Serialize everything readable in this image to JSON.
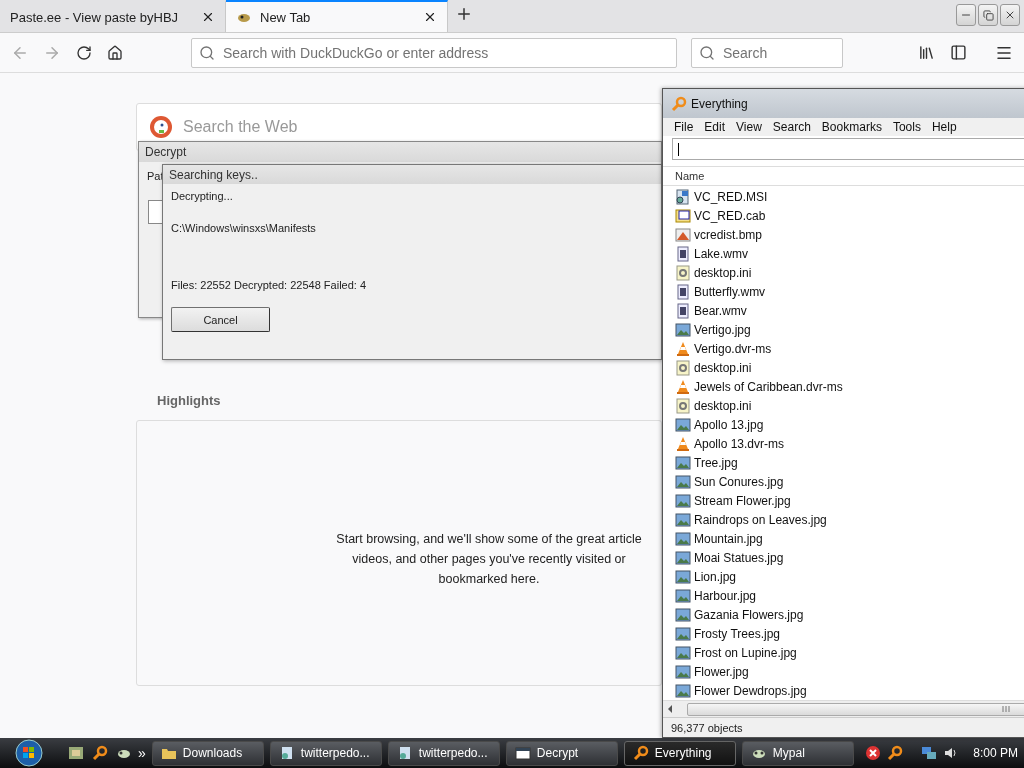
{
  "browser": {
    "tabs": [
      {
        "title": "Paste.ee - View paste byHBJ",
        "selected": false
      },
      {
        "title": "New Tab",
        "selected": true
      }
    ],
    "address_bar": {
      "placeholder": "Search with DuckDuckGo or enter address"
    },
    "search_bar": {
      "placeholder": "Search"
    },
    "page": {
      "web_search": {
        "placeholder": "Search the Web"
      },
      "highlights": {
        "heading": "Highlights",
        "message_lines": [
          "Start browsing, and we'll show some of the great article",
          "videos, and other pages you've recently visited or",
          "bookmarked here."
        ]
      }
    }
  },
  "decrypt_window": {
    "title": "Decrypt",
    "label": "Pat"
  },
  "progress_dialog": {
    "title": "Searching keys..",
    "status": "Decrypting...",
    "path": "C:\\Windows\\winsxs\\Manifests",
    "summary": "Files: 22552 Decrypted: 22548 Failed: 4",
    "button": "Cancel"
  },
  "everything_window": {
    "title": "Everything",
    "menu": [
      "File",
      "Edit",
      "View",
      "Search",
      "Bookmarks",
      "Tools",
      "Help"
    ],
    "column": "Name",
    "files": [
      {
        "name": "VC_RED.MSI",
        "kind": "msi"
      },
      {
        "name": "VC_RED.cab",
        "kind": "cab"
      },
      {
        "name": "vcredist.bmp",
        "kind": "bmp"
      },
      {
        "name": "Lake.wmv",
        "kind": "video"
      },
      {
        "name": "desktop.ini",
        "kind": "ini"
      },
      {
        "name": "Butterfly.wmv",
        "kind": "video"
      },
      {
        "name": "Bear.wmv",
        "kind": "video"
      },
      {
        "name": "Vertigo.jpg",
        "kind": "image"
      },
      {
        "name": "Vertigo.dvr-ms",
        "kind": "cone"
      },
      {
        "name": "desktop.ini",
        "kind": "ini"
      },
      {
        "name": "Jewels of Caribbean.dvr-ms",
        "kind": "cone"
      },
      {
        "name": "desktop.ini",
        "kind": "ini"
      },
      {
        "name": "Apollo 13.jpg",
        "kind": "image"
      },
      {
        "name": "Apollo 13.dvr-ms",
        "kind": "cone"
      },
      {
        "name": "Tree.jpg",
        "kind": "image"
      },
      {
        "name": "Sun Conures.jpg",
        "kind": "image"
      },
      {
        "name": "Stream Flower.jpg",
        "kind": "image"
      },
      {
        "name": "Raindrops on Leaves.jpg",
        "kind": "image"
      },
      {
        "name": "Mountain.jpg",
        "kind": "image"
      },
      {
        "name": "Moai Statues.jpg",
        "kind": "image"
      },
      {
        "name": "Lion.jpg",
        "kind": "image"
      },
      {
        "name": "Harbour.jpg",
        "kind": "image"
      },
      {
        "name": "Gazania Flowers.jpg",
        "kind": "image"
      },
      {
        "name": "Frosty Trees.jpg",
        "kind": "image"
      },
      {
        "name": "Frost on Lupine.jpg",
        "kind": "image"
      },
      {
        "name": "Flower.jpg",
        "kind": "image"
      },
      {
        "name": "Flower Dewdrops.jpg",
        "kind": "image"
      }
    ],
    "status": "96,377 objects"
  },
  "taskbar": {
    "overflow": "»",
    "buttons": [
      {
        "label": "Downloads",
        "kind": "folder",
        "selected": false
      },
      {
        "label": "twitterpedo...",
        "kind": "installer",
        "selected": false
      },
      {
        "label": "twitterpedo...",
        "kind": "installer",
        "selected": false
      },
      {
        "label": "Decrypt",
        "kind": "window",
        "selected": false
      },
      {
        "label": "Everything",
        "kind": "search",
        "selected": true
      },
      {
        "label": "Mypal",
        "kind": "paw",
        "selected": false
      }
    ],
    "clock": "8:00 PM"
  }
}
